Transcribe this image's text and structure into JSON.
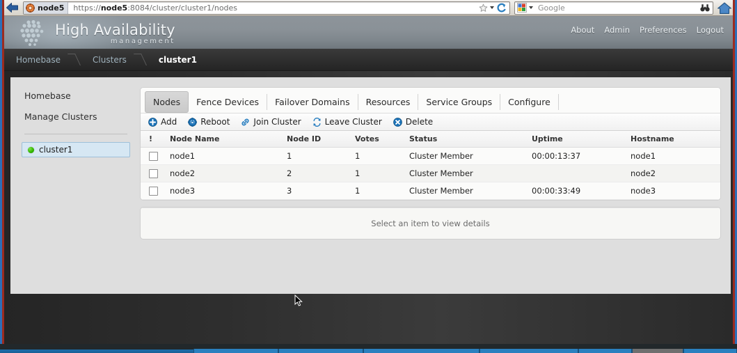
{
  "browser": {
    "back_button": "back-arrow",
    "site_chip_label": "node5",
    "url_prefix": "https://",
    "url_host": "node5",
    "url_suffix": ":8084/cluster/cluster1/nodes",
    "url_full": "https://node5:8084/cluster/cluster1/nodes",
    "star_icon": "bookmark-star-icon",
    "reload_icon": "reload-icon",
    "search_engine": "Google",
    "search_placeholder": "Google",
    "search_go_icon": "binoculars-icon",
    "home_icon": "home-icon"
  },
  "header": {
    "logo_icon": "dot-matrix-logo-icon",
    "title": "High Availability",
    "subtitle": "management",
    "nav": [
      {
        "label": "About"
      },
      {
        "label": "Admin"
      },
      {
        "label": "Preferences"
      },
      {
        "label": "Logout"
      }
    ]
  },
  "breadcrumb": {
    "items": [
      {
        "label": "Homebase",
        "current": false
      },
      {
        "label": "Clusters",
        "current": false
      },
      {
        "label": "cluster1",
        "current": true
      }
    ]
  },
  "sidebar": {
    "links": [
      {
        "label": "Homebase"
      },
      {
        "label": "Manage Clusters"
      }
    ],
    "clusters": [
      {
        "label": "cluster1",
        "status": "online",
        "status_color": "#33b800",
        "selected": true
      }
    ]
  },
  "tabs": [
    {
      "label": "Nodes",
      "active": true
    },
    {
      "label": "Fence Devices",
      "active": false
    },
    {
      "label": "Failover Domains",
      "active": false
    },
    {
      "label": "Resources",
      "active": false
    },
    {
      "label": "Service Groups",
      "active": false
    },
    {
      "label": "Configure",
      "active": false
    }
  ],
  "toolbar": [
    {
      "label": "Add",
      "icon": "plus-circle-icon",
      "color": "#1a72b8"
    },
    {
      "label": "Reboot",
      "icon": "power-gear-icon",
      "color": "#1a72b8"
    },
    {
      "label": "Join Cluster",
      "icon": "chain-link-icon",
      "color": "#2a7fc0"
    },
    {
      "label": "Leave Cluster",
      "icon": "arrows-swap-icon",
      "color": "#2a7fc0"
    },
    {
      "label": "Delete",
      "icon": "x-circle-icon",
      "color": "#1a72b8"
    }
  ],
  "table": {
    "columns": [
      "!",
      "Node Name",
      "Node ID",
      "Votes",
      "Status",
      "Uptime",
      "Hostname"
    ],
    "rows": [
      {
        "checked": false,
        "node_name": "node1",
        "node_id": "1",
        "votes": "1",
        "status": "Cluster Member",
        "uptime": "00:00:13:37",
        "hostname": "node1"
      },
      {
        "checked": false,
        "node_name": "node2",
        "node_id": "2",
        "votes": "1",
        "status": "Cluster Member",
        "uptime": "",
        "hostname": "node2"
      },
      {
        "checked": false,
        "node_name": "node3",
        "node_id": "3",
        "votes": "1",
        "status": "Cluster Member",
        "uptime": "00:00:33:49",
        "hostname": "node3"
      }
    ]
  },
  "details": {
    "empty_message": "Select an item to view details"
  },
  "colors": {
    "accent_blue": "#1a72b8",
    "selection_blue": "#d6e7f3",
    "status_green": "#33b800",
    "page_dark": "#2b2b2b",
    "window_border": "#2c6fb8"
  }
}
